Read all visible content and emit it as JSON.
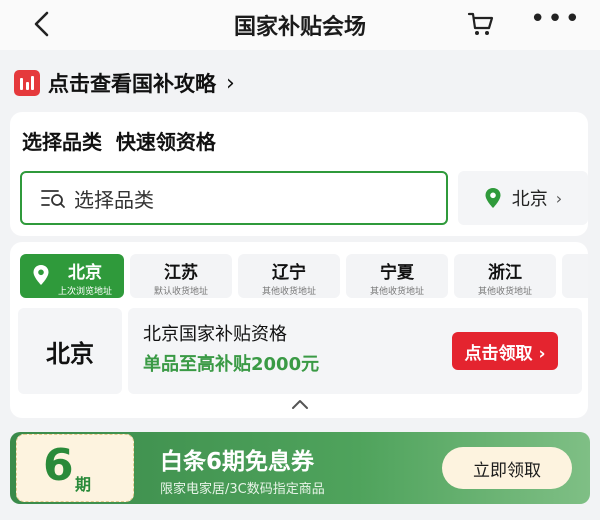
{
  "nav": {
    "title": "国家补贴会场",
    "back_icon": "chevron-left-icon",
    "cart_icon": "cart-icon",
    "more_icon": "more-icon",
    "more_glyph": "•••"
  },
  "guide": {
    "icon": "bar-chart-icon",
    "text": "点击查看国补攻略",
    "chevron": "›"
  },
  "category": {
    "title": "选择品类  快速领资格",
    "placeholder": "选择品类",
    "location": "北京",
    "location_chevron": "›"
  },
  "tabs": [
    {
      "name": "北京",
      "sub": "上次浏览地址",
      "active": true
    },
    {
      "name": "江苏",
      "sub": "默认收货地址",
      "active": false
    },
    {
      "name": "辽宁",
      "sub": "其他收货地址",
      "active": false
    },
    {
      "name": "宁夏",
      "sub": "其他收货地址",
      "active": false
    },
    {
      "name": "浙江",
      "sub": "其他收货地址",
      "active": false
    }
  ],
  "subsidy": {
    "city": "北京",
    "title": "北京国家补贴资格",
    "subtitle": "单品至高补贴2000元",
    "button": "点击领取 ›"
  },
  "promo": {
    "number": "6",
    "unit": "期",
    "title": "白条6期免息券",
    "subtitle": "限家电家居/3C数码指定商品",
    "button": "立即领取"
  },
  "colors": {
    "brand_green": "#2f9a3b",
    "accent_red": "#e4242f",
    "icon_red": "#e5393c"
  }
}
